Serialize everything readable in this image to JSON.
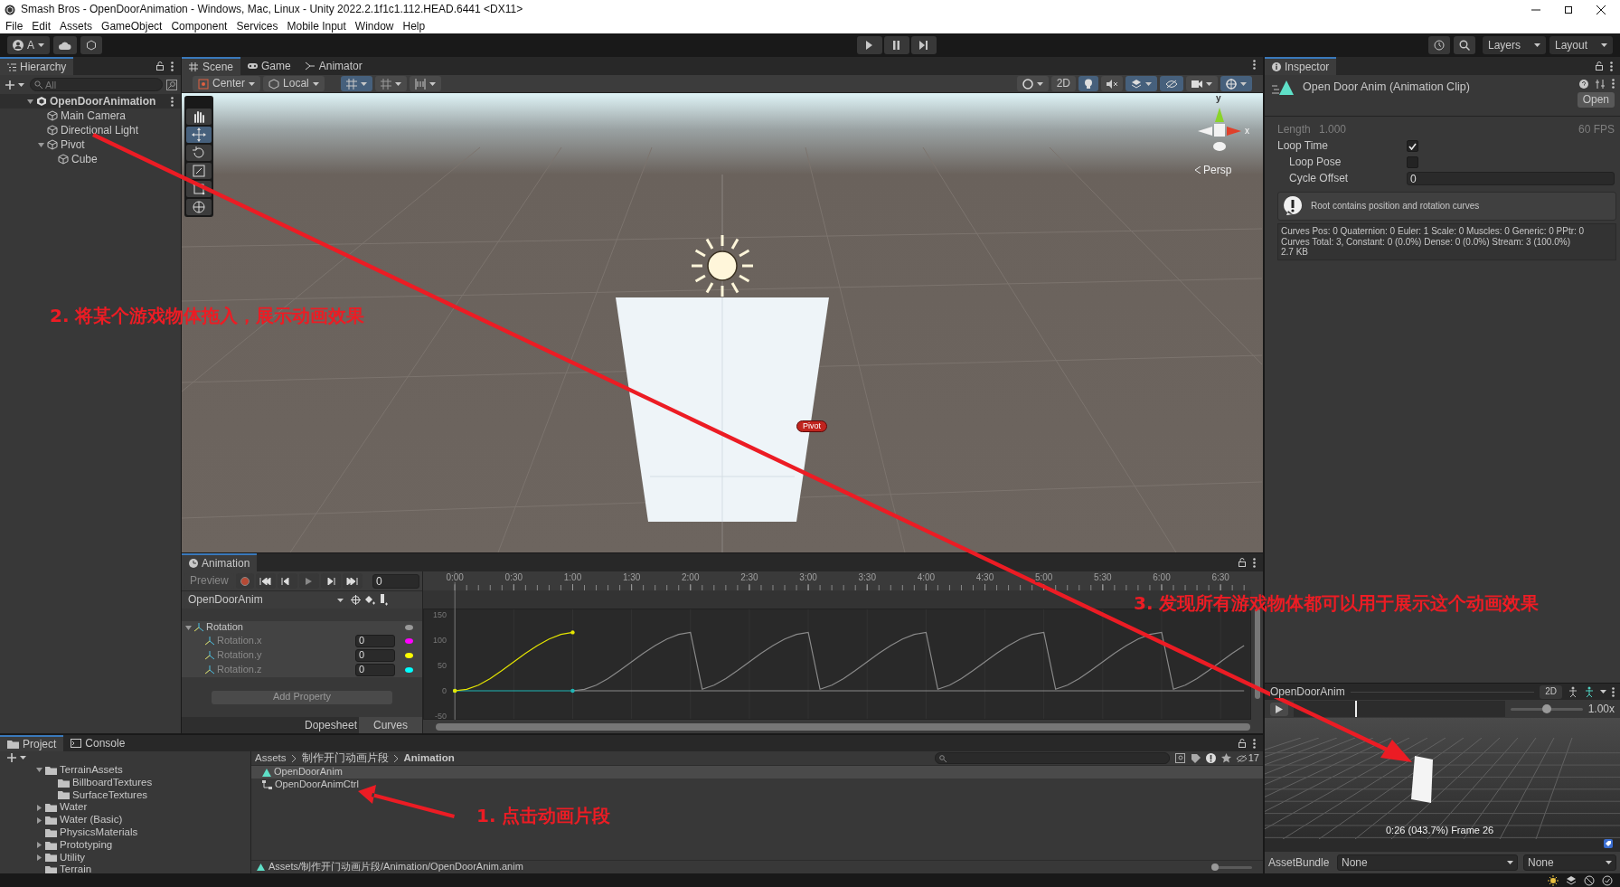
{
  "window": {
    "title": "Smash Bros - OpenDoorAnimation - Windows, Mac, Linux - Unity 2022.2.1f1c1.112.HEAD.6441 <DX11>"
  },
  "menu": [
    "File",
    "Edit",
    "Assets",
    "GameObject",
    "Component",
    "Services",
    "Mobile Input",
    "Window",
    "Help"
  ],
  "toolbar": {
    "account": "A",
    "layers": "Layers",
    "layout": "Layout"
  },
  "hierarchy": {
    "title": "Hierarchy",
    "search_placeholder": "All",
    "scene": {
      "label": "OpenDoorAnimation",
      "expanded": true,
      "children": [
        {
          "label": "Main Camera"
        },
        {
          "label": "Directional Light"
        },
        {
          "label": "Pivot",
          "expanded": true,
          "children": [
            {
              "label": "Cube"
            }
          ]
        }
      ]
    }
  },
  "scene_tabs": [
    {
      "label": "Scene",
      "selected": true
    },
    {
      "label": "Game",
      "selected": false
    },
    {
      "label": "Animator",
      "selected": false
    }
  ],
  "scene_toolbar": {
    "pivot": "Center",
    "space": "Local",
    "mode_2d": "2D",
    "grid_snap_on": true,
    "lighting_on": true,
    "audio_on": false,
    "effects_on": true,
    "hidden_on": true,
    "gizmos_on": true
  },
  "scene_tools": [
    {
      "selected": false
    },
    {
      "selected": true
    },
    {
      "selected": false
    },
    {
      "selected": false
    },
    {
      "selected": false
    },
    {
      "selected": false
    }
  ],
  "scene_view": {
    "object_label": "Pivot",
    "axis_y": "y",
    "axis_x": "x",
    "projection": "Persp"
  },
  "inspector": {
    "title": "Inspector",
    "asset_title": "Open Door Anim (Animation Clip)",
    "open_button": "Open",
    "length_label": "Length",
    "length": "1.000",
    "fps": "60 FPS",
    "fields": [
      {
        "kind": "checkbox",
        "label": "Loop Time",
        "checked": true,
        "children": [
          {
            "kind": "checkbox",
            "label": "Loop Pose",
            "checked": false
          },
          {
            "kind": "text",
            "label": "Cycle Offset",
            "value": "0"
          }
        ]
      }
    ],
    "warning": "Root contains position and rotation curves",
    "stats": [
      "Curves Pos: 0 Quaternion: 0 Euler: 1 Scale: 0 Muscles: 0 Generic: 0 PPtr: 0",
      "Curves Total: 3, Constant: 0 (0.0%) Dense: 0 (0.0%) Stream: 3 (100.0%)",
      "2.7 KB"
    ],
    "preview": {
      "clip": "OpenDoorAnim",
      "mode_2d": "2D",
      "time": {
        "level": 0.29
      },
      "speed": {
        "level": 0.5
      },
      "speed_reading": "1.00x",
      "frame_info": "0:26 (043.7%) Frame 26"
    },
    "asset_bundle": {
      "label": "AssetBundle",
      "name": "None",
      "variant": "None"
    }
  },
  "animation": {
    "title": "Animation",
    "preview": "Preview",
    "frame": "0",
    "clip": "OpenDoorAnim",
    "property": {
      "label": "Rotation",
      "expanded": true,
      "children": [
        {
          "label": "Rotation.x",
          "value": "0",
          "color": "#ff00ff"
        },
        {
          "label": "Rotation.y",
          "value": "0",
          "color": "#ffff00"
        },
        {
          "label": "Rotation.z",
          "value": "0",
          "color": "#00ffff"
        }
      ]
    },
    "add_property": "Add Property",
    "view_tabs": [
      {
        "label": "Dopesheet",
        "selected": false
      },
      {
        "label": "Curves",
        "selected": true
      }
    ],
    "chart_data": {
      "type": "line",
      "grid": true,
      "x": [
        0,
        0.1,
        0.2,
        0.3,
        0.4,
        0.5,
        0.6,
        0.7,
        0.8,
        0.9,
        1,
        1.1,
        1.2,
        1.3,
        1.4,
        1.5,
        1.6,
        1.7,
        1.8,
        1.9,
        2,
        2.1,
        2.2,
        2.3,
        2.4,
        2.5,
        2.6,
        2.7,
        2.8,
        2.9,
        3,
        3.1,
        3.2,
        3.3,
        3.4,
        3.5,
        3.6,
        3.7,
        3.8,
        3.9,
        4,
        4.1,
        4.2,
        4.3,
        4.4,
        4.5,
        4.6,
        4.7,
        4.8,
        4.9,
        5,
        5.1,
        5.2,
        5.3,
        5.4,
        5.5,
        5.6,
        5.7,
        5.8,
        5.9,
        6,
        6.1,
        6.2,
        6.3,
        6.4,
        6.5,
        6.6,
        6.7
      ],
      "series": [
        {
          "color": "#8a8a8a",
          "values": [
            null,
            null,
            null,
            null,
            null,
            null,
            null,
            null,
            null,
            null,
            0,
            3,
            11,
            24,
            40,
            57,
            74,
            89,
            102,
            111,
            115,
            3,
            11,
            24,
            40,
            57,
            74,
            89,
            102,
            111,
            115,
            3,
            11,
            24,
            40,
            57,
            74,
            89,
            102,
            111,
            115,
            3,
            11,
            24,
            40,
            57,
            74,
            89,
            102,
            111,
            115,
            3,
            11,
            24,
            40,
            57,
            74,
            89,
            102,
            111,
            115,
            3,
            11,
            24,
            40,
            57,
            74,
            89
          ]
        },
        {
          "color": "#8a8a8a",
          "values": [
            null,
            null,
            null,
            null,
            null,
            null,
            null,
            null,
            null,
            null,
            0,
            0,
            0,
            0,
            0,
            0,
            0,
            0,
            0,
            0,
            0,
            0,
            0,
            0,
            0,
            0,
            0,
            0,
            0,
            0,
            0,
            0,
            0,
            0,
            0,
            0,
            0,
            0,
            0,
            0,
            0,
            0,
            0,
            0,
            0,
            0,
            0,
            0,
            0,
            0,
            0,
            0,
            0,
            0,
            0,
            0,
            0,
            0,
            0,
            0,
            0,
            0,
            0,
            0,
            0,
            0,
            0,
            0
          ]
        },
        {
          "color": "#1fb5b5",
          "values": [
            0,
            0,
            0,
            0,
            0,
            0,
            0,
            0,
            0,
            0,
            0,
            null,
            null,
            null,
            null,
            null,
            null,
            null,
            null,
            null,
            null,
            null,
            null,
            null,
            null,
            null,
            null,
            null,
            null,
            null,
            null,
            null,
            null,
            null,
            null,
            null,
            null,
            null,
            null,
            null,
            null,
            null,
            null,
            null,
            null,
            null,
            null,
            null,
            null,
            null,
            null,
            null,
            null,
            null,
            null,
            null,
            null,
            null,
            null,
            null,
            null,
            null,
            null,
            null,
            null,
            null,
            null,
            null
          ]
        },
        {
          "color": "#e5e500",
          "values": [
            0,
            3,
            11,
            24,
            40,
            57,
            74,
            89,
            102,
            111,
            115,
            null,
            null,
            null,
            null,
            null,
            null,
            null,
            null,
            null,
            null,
            null,
            null,
            null,
            null,
            null,
            null,
            null,
            null,
            null,
            null,
            null,
            null,
            null,
            null,
            null,
            null,
            null,
            null,
            null,
            null,
            null,
            null,
            null,
            null,
            null,
            null,
            null,
            null,
            null,
            null,
            null,
            null,
            null,
            null,
            null,
            null,
            null,
            null,
            null,
            null,
            null,
            null,
            null,
            null,
            null,
            null,
            null
          ]
        }
      ],
      "xlim": [
        -0.27,
        6.76
      ],
      "ylim": [
        -57,
        235
      ],
      "xticks": [
        {
          "value": 0,
          "label": "0:00"
        },
        {
          "value": 0.5,
          "label": "0:30"
        },
        {
          "value": 1,
          "label": "1:00"
        },
        {
          "value": 1.5,
          "label": "1:30"
        },
        {
          "value": 2,
          "label": "2:00"
        },
        {
          "value": 2.5,
          "label": "2:30"
        },
        {
          "value": 3,
          "label": "3:00"
        },
        {
          "value": 3.5,
          "label": "3:30"
        },
        {
          "value": 4,
          "label": "4:00"
        },
        {
          "value": 4.5,
          "label": "4:30"
        },
        {
          "value": 5,
          "label": "5:00"
        },
        {
          "value": 5.5,
          "label": "5:30"
        },
        {
          "value": 6,
          "label": "6:00"
        },
        {
          "value": 6.5,
          "label": "6:30"
        }
      ],
      "yticks": [
        -50,
        0,
        50,
        100,
        150
      ]
    }
  },
  "project": {
    "tabs": [
      {
        "label": "Project",
        "selected": true
      },
      {
        "label": "Console",
        "selected": false
      }
    ],
    "tree": [
      {
        "label": "TerrainAssets",
        "expanded": true,
        "children": [
          {
            "label": "BillboardTextures"
          },
          {
            "label": "SurfaceTextures"
          }
        ]
      },
      {
        "label": "Water",
        "expanded": false
      },
      {
        "label": "Water (Basic)",
        "expanded": false
      },
      {
        "label": "PhysicsMaterials"
      },
      {
        "label": "Prototyping",
        "expanded": false
      },
      {
        "label": "Utility",
        "expanded": false
      },
      {
        "label": "Terrain"
      }
    ],
    "breadcrumb": [
      "Assets",
      "制作开门动画片段",
      "Animation"
    ],
    "files": [
      {
        "kind": "clip",
        "label": "OpenDoorAnim",
        "selected": true
      },
      {
        "kind": "controller",
        "label": "OpenDoorAnimCtrl",
        "selected": false
      }
    ],
    "hidden_count": "17",
    "path": "Assets/制作开门动画片段/Animation/OpenDoorAnim.anim",
    "zoom": {
      "level": 0.1
    }
  },
  "annotations": [
    {
      "text": "1. 点击动画片段"
    },
    {
      "text": "2. 将某个游戏物体拖入，展示动画效果"
    },
    {
      "text": "3. 发现所有游戏物体都可以用于展示这个动画效果"
    }
  ]
}
